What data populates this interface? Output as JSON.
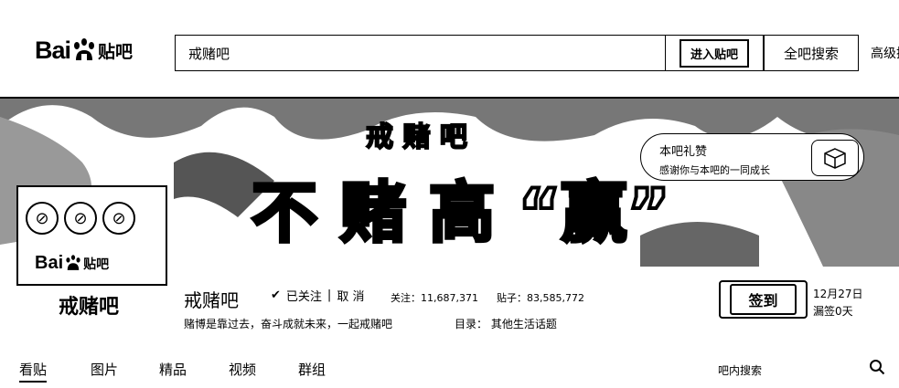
{
  "header": {
    "logo_text": "Bai",
    "logo_suffix": "贴吧",
    "search_value": "戒赌吧",
    "enter_button": "进入贴吧",
    "all_search_button": "全吧搜索",
    "advanced_link": "高级搜索"
  },
  "banner": {
    "title_small": "戒 赌 吧",
    "title_big": "不 赌 高 “赢”"
  },
  "gift_popup": {
    "title": "本吧礼赞",
    "subtitle": "感谢你与本吧的一同成长"
  },
  "forum": {
    "avatar_logo": "Bai",
    "avatar_logo_suffix": "贴吧",
    "avatar_name": "戒赌吧",
    "name": "戒赌吧",
    "followed": "已关注",
    "unfollow": "取 消",
    "followers_label": "关注：",
    "followers": "11,687,371",
    "posts_label": "贴子：",
    "posts": "83,585,772",
    "slogan": "赌博是靠过去，奋斗成就未来，一起戒赌吧",
    "directory_label": "目录：",
    "directory": "其他生活话题",
    "signin": "签到",
    "date": "12月27日",
    "missed": "漏签0天"
  },
  "tabs": [
    {
      "label": "看贴"
    },
    {
      "label": "图片"
    },
    {
      "label": "精品"
    },
    {
      "label": "视频"
    },
    {
      "label": "群组"
    }
  ],
  "inner_search": "吧内搜索"
}
